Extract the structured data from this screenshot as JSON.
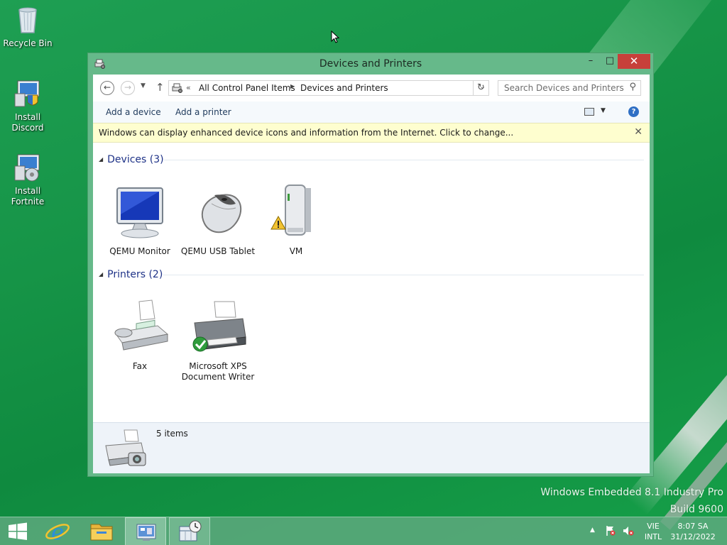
{
  "desktop": {
    "icons": [
      {
        "label": "Recycle Bin",
        "icon": "recycle-bin-icon"
      },
      {
        "label": "Install Discord",
        "icon": "installer-icon"
      },
      {
        "label": "Install Fortnite",
        "icon": "installer-icon"
      }
    ],
    "watermark": {
      "line1": "Windows Embedded 8.1 Industry Pro",
      "line2": "Build 9600"
    }
  },
  "window": {
    "title": "Devices and Printers",
    "controls": {
      "minimize": "–",
      "maximize": "□",
      "close": "✕"
    },
    "address": {
      "crumbs": [
        "All Control Panel Items",
        "Devices and Printers"
      ]
    },
    "search": {
      "placeholder": "Search Devices and Printers"
    },
    "commands": {
      "add_device": "Add a device",
      "add_printer": "Add a printer"
    },
    "infobar": {
      "message": "Windows can display enhanced device icons and information from the Internet. Click to change..."
    },
    "groups": {
      "devices": {
        "title": "Devices (3)",
        "items": [
          {
            "label": "QEMU Monitor",
            "icon": "monitor-icon"
          },
          {
            "label": "QEMU USB Tablet",
            "icon": "mouse-icon"
          },
          {
            "label": "VM",
            "icon": "computer-tower-icon",
            "status": "warning"
          }
        ]
      },
      "printers": {
        "title": "Printers (2)",
        "items": [
          {
            "label": "Fax",
            "icon": "fax-icon"
          },
          {
            "label": "Microsoft XPS Document Writer",
            "icon": "printer-icon",
            "status": "default"
          }
        ]
      }
    },
    "details": {
      "count": "5 items"
    }
  },
  "taskbar": {
    "items": [
      "start-icon",
      "internet-explorer-icon",
      "file-explorer-icon",
      "devices-and-printers-icon",
      "clock-app-icon"
    ],
    "language": {
      "line1": "VIE",
      "line2": "INTL"
    },
    "clock": {
      "time": "8:07 SA",
      "date": "31/12/2022"
    }
  },
  "colors": {
    "accent": "#66b98a",
    "close": "#c7403a",
    "link": "#1e3287",
    "infobar": "#fefecf"
  }
}
